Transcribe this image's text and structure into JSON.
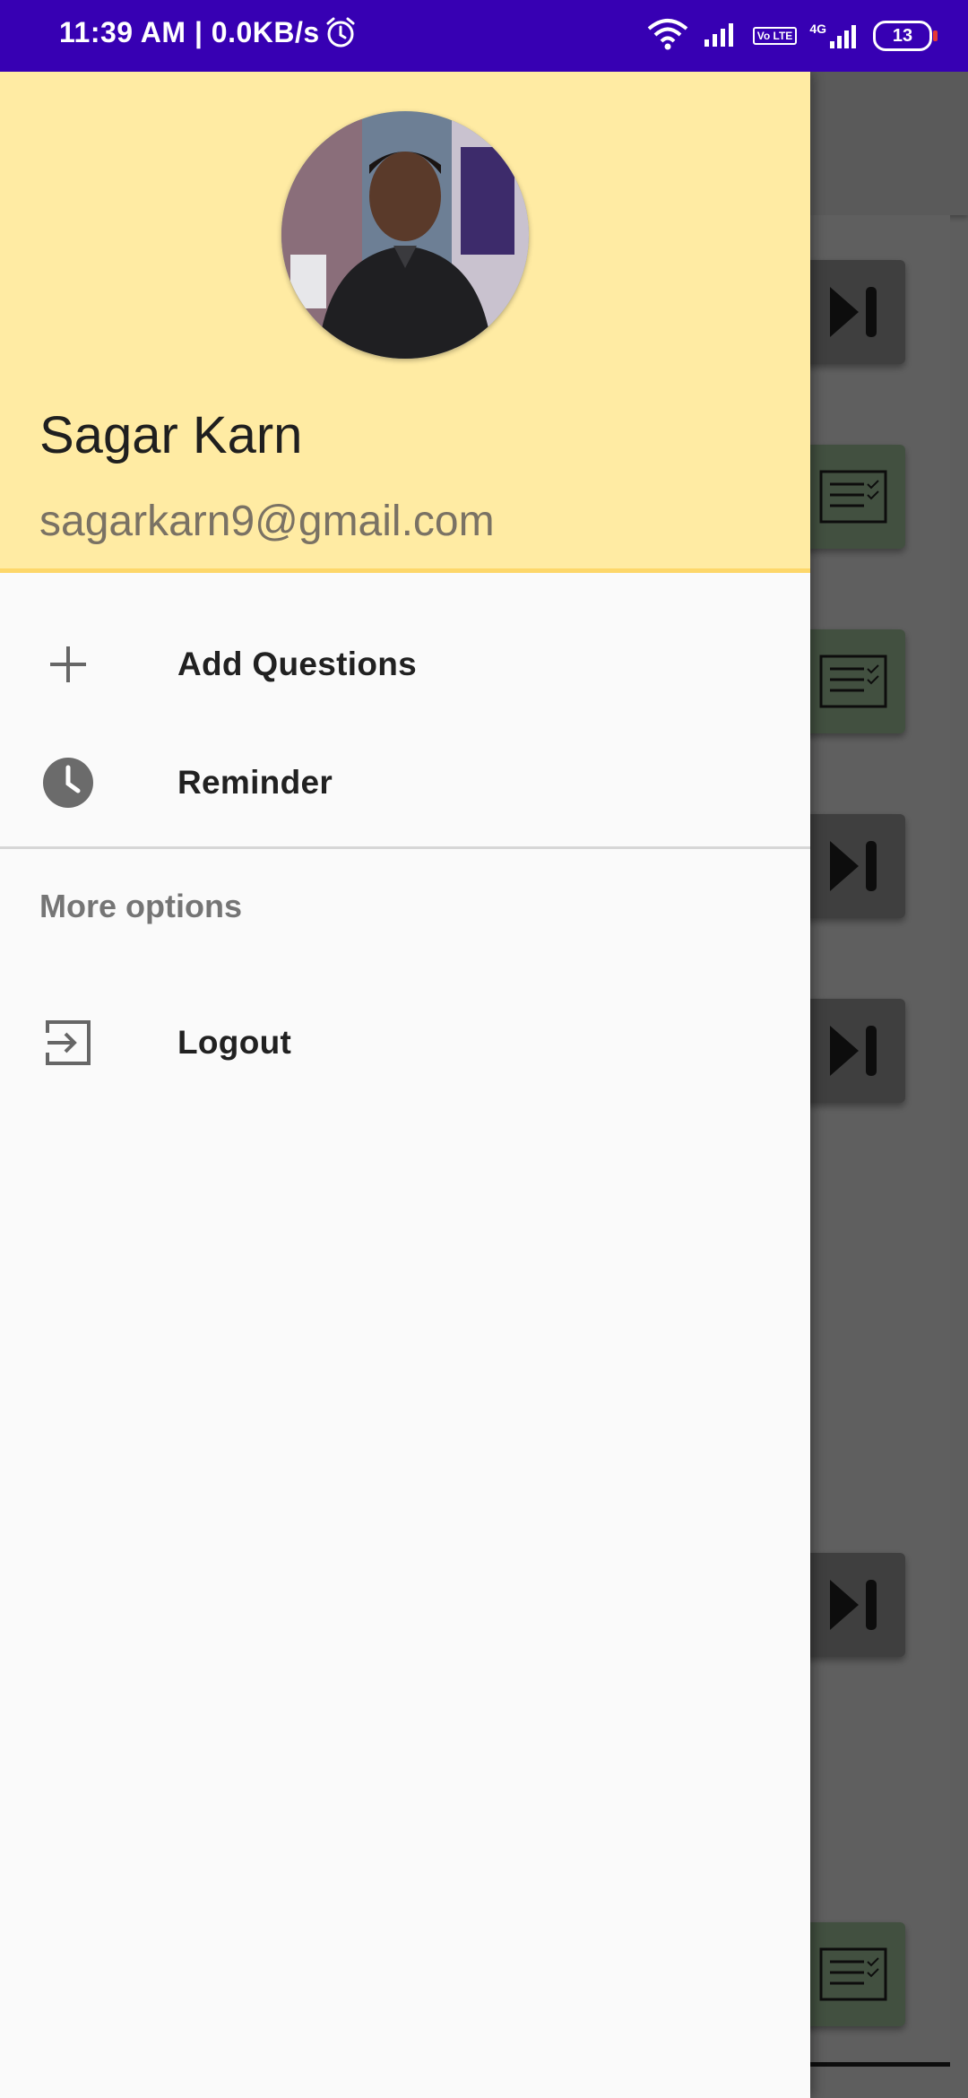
{
  "status_bar": {
    "time": "11:39 AM | 0.0KB/s",
    "volte": "Vo LTE",
    "network": "4G",
    "battery": "13"
  },
  "drawer": {
    "header": {
      "name": "Sagar Karn",
      "email": "sagarkarn9@gmail.com"
    },
    "items": [
      {
        "label": "Add Questions",
        "icon": "plus-icon"
      },
      {
        "label": "Reminder",
        "icon": "clock-icon"
      }
    ],
    "section_title": "More options",
    "more_items": [
      {
        "label": "Logout",
        "icon": "logout-icon"
      }
    ]
  },
  "colors": {
    "status_bar": "#3700b3",
    "header_bg": "#ffeba3",
    "header_border": "#fdd76a"
  }
}
